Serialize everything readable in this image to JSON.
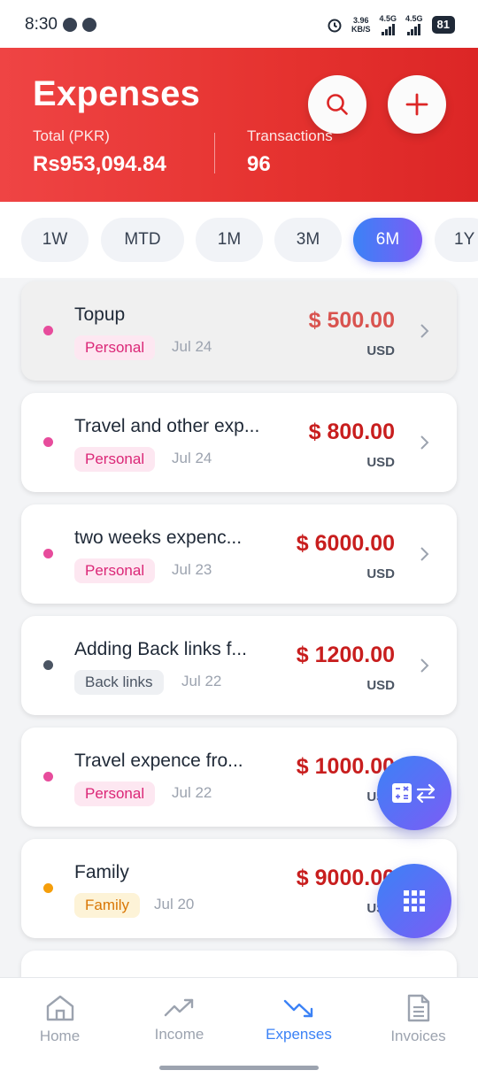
{
  "status": {
    "time": "8:30",
    "net_speed_top": "3.96",
    "net_speed_bottom": "KB/S",
    "net1": "4.5G",
    "net2": "4.5G",
    "battery": "81"
  },
  "header": {
    "title": "Expenses",
    "total_label": "Total (PKR)",
    "total_value": "Rs953,094.84",
    "transactions_label": "Transactions",
    "transactions_value": "96",
    "search_icon": "search-icon",
    "add_icon": "plus-icon"
  },
  "ranges": [
    {
      "label": "1W"
    },
    {
      "label": "MTD"
    },
    {
      "label": "1M"
    },
    {
      "label": "3M"
    },
    {
      "label": "6M",
      "active": true
    },
    {
      "label": "1Y"
    }
  ],
  "transactions": [
    {
      "title": "Topup",
      "tag": "Personal",
      "date": "Jul 24",
      "amount": "$ 500.00",
      "currency": "USD",
      "dot_color": "#e74c9c"
    },
    {
      "title": "Travel and other exp...",
      "tag": "Personal",
      "date": "Jul 24",
      "amount": "$ 800.00",
      "currency": "USD",
      "dot_color": "#e74c9c"
    },
    {
      "title": "two weeks expenc...",
      "tag": "Personal",
      "date": "Jul 23",
      "amount": "$ 6000.00",
      "currency": "USD",
      "dot_color": "#e74c9c"
    },
    {
      "title": "Adding Back links f...",
      "tag": "Back links",
      "date": "Jul 22",
      "amount": "$ 1200.00",
      "currency": "USD",
      "dot_color": "#4b5563"
    },
    {
      "title": "Travel expence fro...",
      "tag": "Personal",
      "date": "Jul 22",
      "amount": "$ 1000.00",
      "currency": "USD",
      "dot_color": "#e74c9c"
    },
    {
      "title": "Family",
      "tag": "Family",
      "date": "Jul 20",
      "amount": "$ 9000.00",
      "currency": "USD",
      "dot_color": "#f59e0b"
    }
  ],
  "fabs": {
    "calc_icon": "calculator-convert-icon",
    "grid_icon": "grid-icon"
  },
  "nav": [
    {
      "label": "Home",
      "icon": "home-icon"
    },
    {
      "label": "Income",
      "icon": "trending-up-icon"
    },
    {
      "label": "Expenses",
      "icon": "trending-down-icon",
      "active": true
    },
    {
      "label": "Invoices",
      "icon": "document-icon"
    }
  ],
  "colors": {
    "header_red": "#e5322f",
    "accent_blue": "#3b82f6",
    "accent_purple": "#7c5cf5",
    "amount_red": "#c81e1e"
  }
}
